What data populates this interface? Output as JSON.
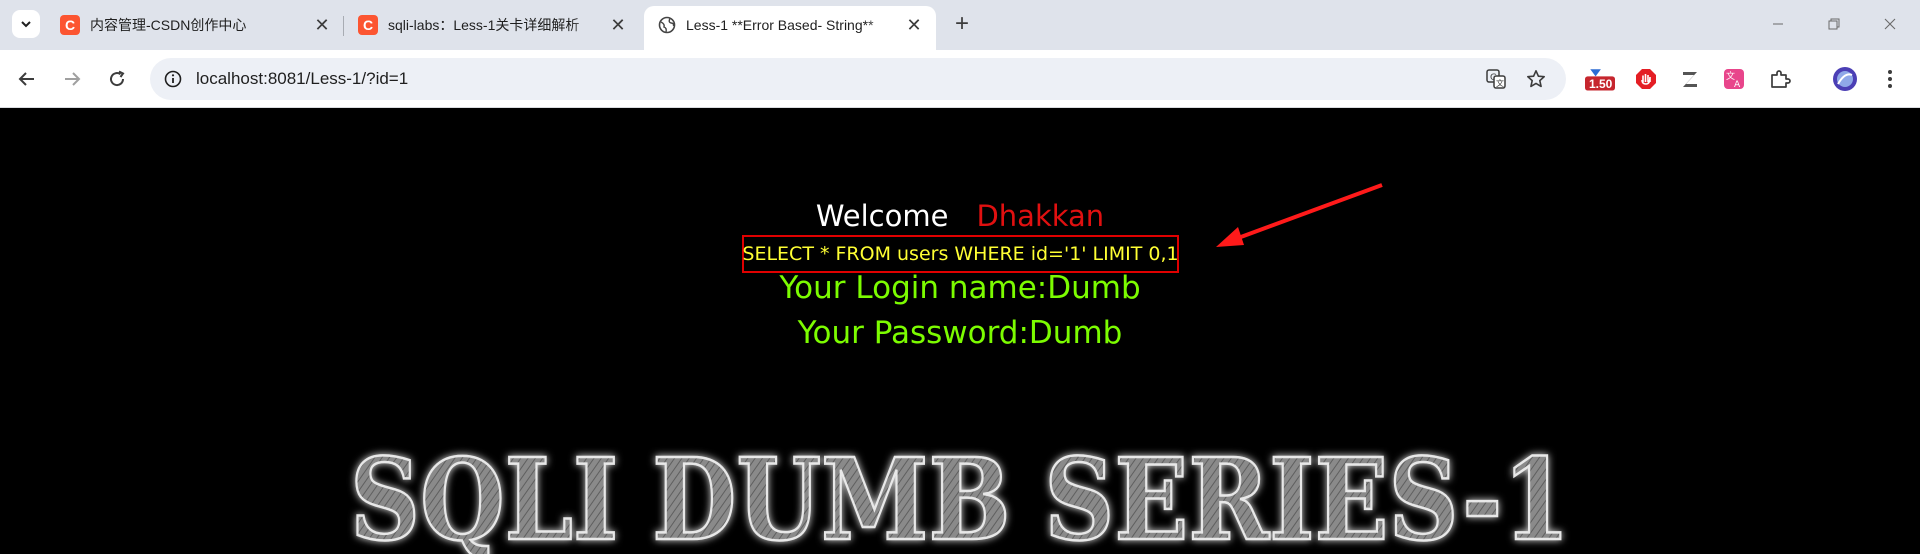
{
  "browser": {
    "tabs": [
      {
        "title": "内容管理-CSDN创作中心",
        "favicon": "csdn-c-icon",
        "active": false
      },
      {
        "title": "sqli-labs：Less-1关卡详细解析",
        "favicon": "csdn-c-icon",
        "active": false
      },
      {
        "title": "Less-1 **Error Based- String**",
        "favicon": "globe-icon",
        "active": true
      }
    ],
    "favicon_letter": "C",
    "close_glyph": "✕",
    "newtab_glyph": "+",
    "url": "localhost:8081/Less-1/?id=1",
    "extension_badge": "1.50",
    "colors": {
      "tabstrip": "#dfe3eb",
      "omnibox": "#edf0f6",
      "csdn": "#fc5531"
    }
  },
  "page": {
    "welcome": "Welcome",
    "name": "Dhakkan",
    "sql_query": "SELECT * FROM users WHERE id='1' LIMIT 0,1",
    "login_name": "Your Login name:Dumb",
    "password": "Your Password:Dumb",
    "banner": "SQLI DUMB SERIES-1",
    "colors": {
      "background": "#000000",
      "welcome": "#ffffff",
      "name": "#e01010",
      "sql": "#ffff33",
      "result": "#7cfc00",
      "annotation": "#e00000"
    }
  }
}
